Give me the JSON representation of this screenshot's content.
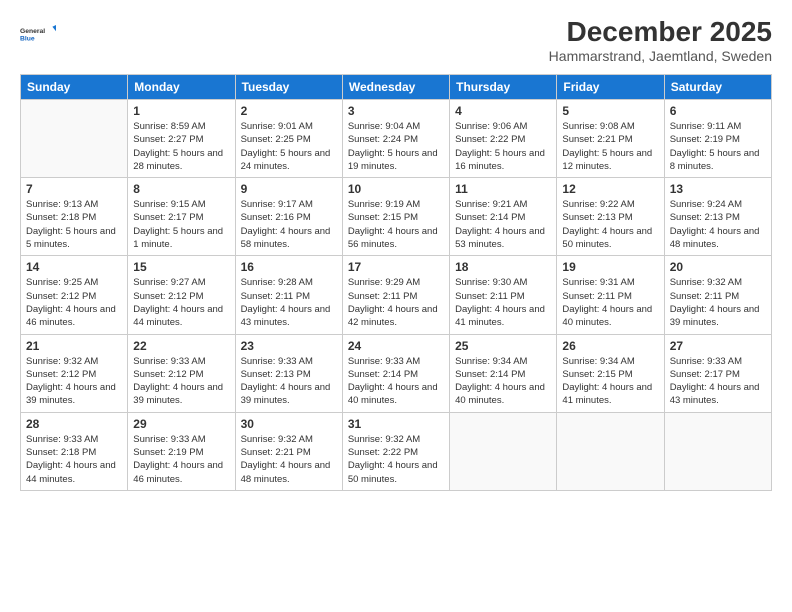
{
  "logo": {
    "general": "General",
    "blue": "Blue"
  },
  "title": "December 2025",
  "location": "Hammarstrand, Jaemtland, Sweden",
  "days_header": [
    "Sunday",
    "Monday",
    "Tuesday",
    "Wednesday",
    "Thursday",
    "Friday",
    "Saturday"
  ],
  "weeks": [
    [
      {
        "day": "",
        "info": ""
      },
      {
        "day": "1",
        "info": "Sunrise: 8:59 AM\nSunset: 2:27 PM\nDaylight: 5 hours\nand 28 minutes."
      },
      {
        "day": "2",
        "info": "Sunrise: 9:01 AM\nSunset: 2:25 PM\nDaylight: 5 hours\nand 24 minutes."
      },
      {
        "day": "3",
        "info": "Sunrise: 9:04 AM\nSunset: 2:24 PM\nDaylight: 5 hours\nand 19 minutes."
      },
      {
        "day": "4",
        "info": "Sunrise: 9:06 AM\nSunset: 2:22 PM\nDaylight: 5 hours\nand 16 minutes."
      },
      {
        "day": "5",
        "info": "Sunrise: 9:08 AM\nSunset: 2:21 PM\nDaylight: 5 hours\nand 12 minutes."
      },
      {
        "day": "6",
        "info": "Sunrise: 9:11 AM\nSunset: 2:19 PM\nDaylight: 5 hours\nand 8 minutes."
      }
    ],
    [
      {
        "day": "7",
        "info": "Sunrise: 9:13 AM\nSunset: 2:18 PM\nDaylight: 5 hours\nand 5 minutes."
      },
      {
        "day": "8",
        "info": "Sunrise: 9:15 AM\nSunset: 2:17 PM\nDaylight: 5 hours\nand 1 minute."
      },
      {
        "day": "9",
        "info": "Sunrise: 9:17 AM\nSunset: 2:16 PM\nDaylight: 4 hours\nand 58 minutes."
      },
      {
        "day": "10",
        "info": "Sunrise: 9:19 AM\nSunset: 2:15 PM\nDaylight: 4 hours\nand 56 minutes."
      },
      {
        "day": "11",
        "info": "Sunrise: 9:21 AM\nSunset: 2:14 PM\nDaylight: 4 hours\nand 53 minutes."
      },
      {
        "day": "12",
        "info": "Sunrise: 9:22 AM\nSunset: 2:13 PM\nDaylight: 4 hours\nand 50 minutes."
      },
      {
        "day": "13",
        "info": "Sunrise: 9:24 AM\nSunset: 2:13 PM\nDaylight: 4 hours\nand 48 minutes."
      }
    ],
    [
      {
        "day": "14",
        "info": "Sunrise: 9:25 AM\nSunset: 2:12 PM\nDaylight: 4 hours\nand 46 minutes."
      },
      {
        "day": "15",
        "info": "Sunrise: 9:27 AM\nSunset: 2:12 PM\nDaylight: 4 hours\nand 44 minutes."
      },
      {
        "day": "16",
        "info": "Sunrise: 9:28 AM\nSunset: 2:11 PM\nDaylight: 4 hours\nand 43 minutes."
      },
      {
        "day": "17",
        "info": "Sunrise: 9:29 AM\nSunset: 2:11 PM\nDaylight: 4 hours\nand 42 minutes."
      },
      {
        "day": "18",
        "info": "Sunrise: 9:30 AM\nSunset: 2:11 PM\nDaylight: 4 hours\nand 41 minutes."
      },
      {
        "day": "19",
        "info": "Sunrise: 9:31 AM\nSunset: 2:11 PM\nDaylight: 4 hours\nand 40 minutes."
      },
      {
        "day": "20",
        "info": "Sunrise: 9:32 AM\nSunset: 2:11 PM\nDaylight: 4 hours\nand 39 minutes."
      }
    ],
    [
      {
        "day": "21",
        "info": "Sunrise: 9:32 AM\nSunset: 2:12 PM\nDaylight: 4 hours\nand 39 minutes."
      },
      {
        "day": "22",
        "info": "Sunrise: 9:33 AM\nSunset: 2:12 PM\nDaylight: 4 hours\nand 39 minutes."
      },
      {
        "day": "23",
        "info": "Sunrise: 9:33 AM\nSunset: 2:13 PM\nDaylight: 4 hours\nand 39 minutes."
      },
      {
        "day": "24",
        "info": "Sunrise: 9:33 AM\nSunset: 2:14 PM\nDaylight: 4 hours\nand 40 minutes."
      },
      {
        "day": "25",
        "info": "Sunrise: 9:34 AM\nSunset: 2:14 PM\nDaylight: 4 hours\nand 40 minutes."
      },
      {
        "day": "26",
        "info": "Sunrise: 9:34 AM\nSunset: 2:15 PM\nDaylight: 4 hours\nand 41 minutes."
      },
      {
        "day": "27",
        "info": "Sunrise: 9:33 AM\nSunset: 2:17 PM\nDaylight: 4 hours\nand 43 minutes."
      }
    ],
    [
      {
        "day": "28",
        "info": "Sunrise: 9:33 AM\nSunset: 2:18 PM\nDaylight: 4 hours\nand 44 minutes."
      },
      {
        "day": "29",
        "info": "Sunrise: 9:33 AM\nSunset: 2:19 PM\nDaylight: 4 hours\nand 46 minutes."
      },
      {
        "day": "30",
        "info": "Sunrise: 9:32 AM\nSunset: 2:21 PM\nDaylight: 4 hours\nand 48 minutes."
      },
      {
        "day": "31",
        "info": "Sunrise: 9:32 AM\nSunset: 2:22 PM\nDaylight: 4 hours\nand 50 minutes."
      },
      {
        "day": "",
        "info": ""
      },
      {
        "day": "",
        "info": ""
      },
      {
        "day": "",
        "info": ""
      }
    ]
  ]
}
